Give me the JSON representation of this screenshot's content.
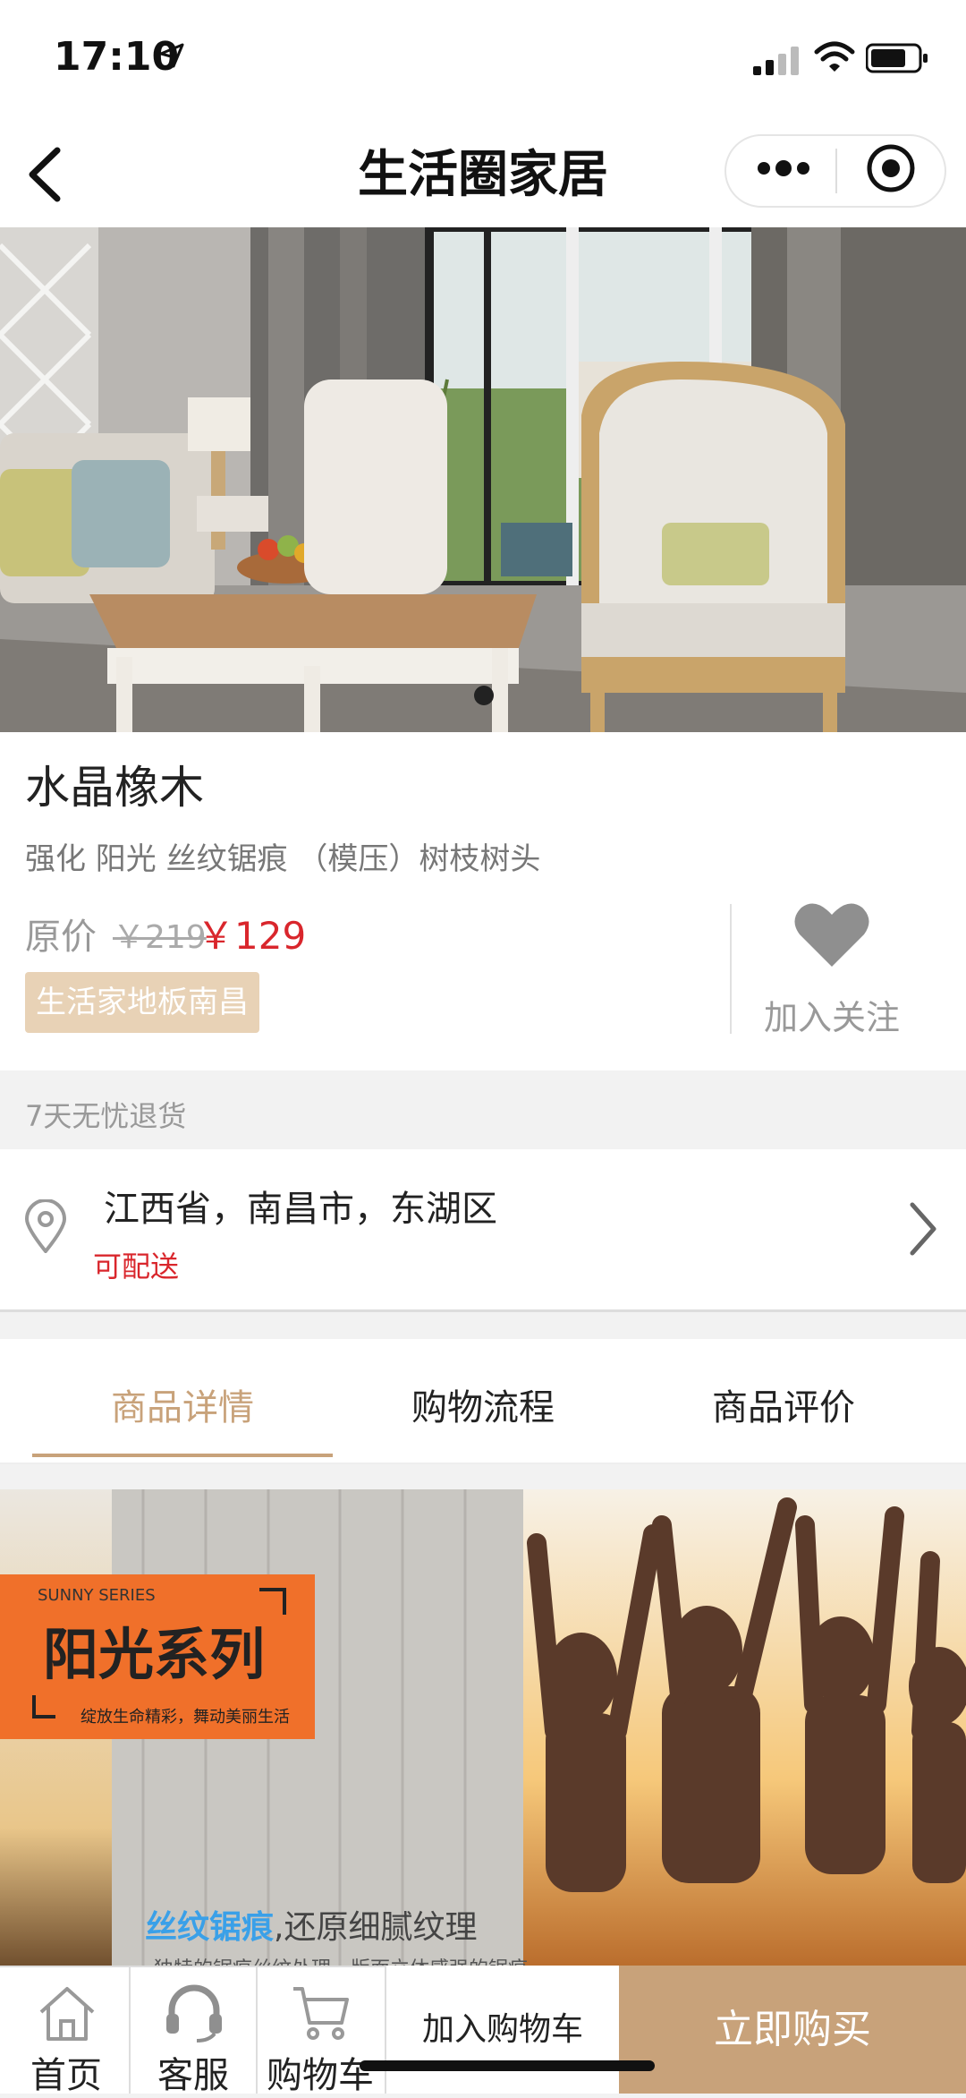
{
  "status": {
    "time": "17:10"
  },
  "nav": {
    "title": "生活圈家居"
  },
  "product": {
    "name": "水晶橡木",
    "desc": "强化 阳光 丝纹锯痕 （模压）树枝树头",
    "orig_label": "原价",
    "orig_price": "￥219",
    "sale_price": "￥129",
    "store_tag": "生活家地板南昌",
    "follow_label": "加入关注"
  },
  "return_policy": "7天无忧退货",
  "address": {
    "text": "江西省，南昌市，东湖区",
    "status": "可配送"
  },
  "tabs": [
    "商品详情",
    "购物流程",
    "商品评价"
  ],
  "detail_banner": {
    "series_en": "SUNNY SERIES",
    "series_cn": "阳光系列",
    "slogan": "绽放生命精彩，舞动美丽生活",
    "caption_highlight": "丝纹锯痕",
    "caption_rest": ",还原细腻纹理",
    "caption_sub": "独特的锯痕丝纹处理，版面立体感强的锯痕"
  },
  "bottom_bar": {
    "home": "首页",
    "service": "客服",
    "cart": "购物车",
    "add_cart": "加入购物车",
    "buy_now": "立即购买"
  },
  "colors": {
    "accent": "#c8a27a",
    "price_red": "#d9262c",
    "tag_bg": "#e8d2b6"
  }
}
